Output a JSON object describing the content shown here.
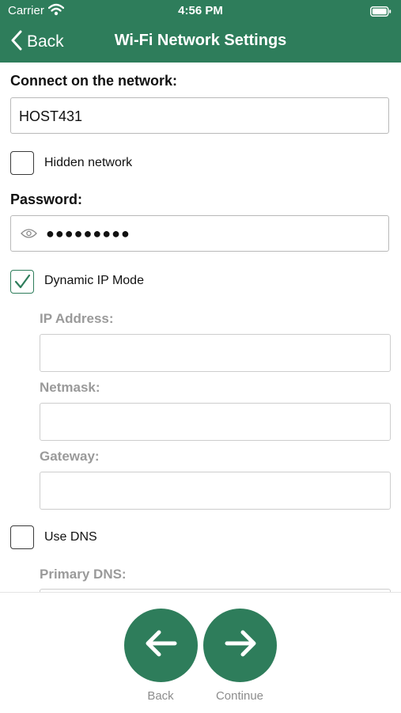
{
  "status_bar": {
    "carrier": "Carrier",
    "time": "4:56 PM"
  },
  "nav": {
    "back_label": "Back",
    "title": "Wi-Fi Network Settings"
  },
  "network": {
    "label": "Connect on the network:",
    "value": "HOST431"
  },
  "hidden_network": {
    "label": "Hidden network",
    "checked": false
  },
  "password": {
    "label": "Password:",
    "masked_value": "●●●●●●●●●"
  },
  "dynamic_ip": {
    "label": "Dynamic IP Mode",
    "checked": true
  },
  "ip_address": {
    "label": "IP Address:",
    "value": ""
  },
  "netmask": {
    "label": "Netmask:",
    "value": ""
  },
  "gateway": {
    "label": "Gateway:",
    "value": ""
  },
  "use_dns": {
    "label": "Use DNS",
    "checked": false
  },
  "primary_dns": {
    "label": "Primary DNS:",
    "value": ""
  },
  "footer": {
    "back_label": "Back",
    "continue_label": "Continue"
  },
  "colors": {
    "accent": "#2e7d5b",
    "muted_text": "#9a9a9a"
  },
  "icons": [
    "wifi-icon",
    "battery-icon",
    "chevron-left-icon",
    "eye-icon",
    "checkmark-icon",
    "arrow-left-icon",
    "arrow-right-icon"
  ]
}
